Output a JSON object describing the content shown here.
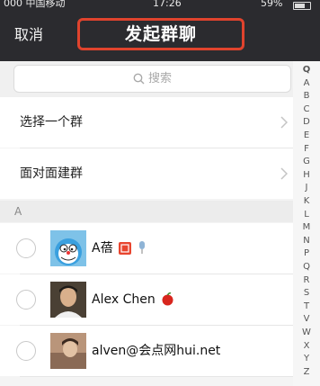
{
  "status_bar": {
    "carrier": "000 中国移动",
    "time": "17:26",
    "battery": "59%"
  },
  "nav": {
    "cancel": "取消",
    "title": "发起群聊"
  },
  "search": {
    "placeholder": "搜索"
  },
  "menu": [
    {
      "label": "选择一个群"
    },
    {
      "label": "面对面建群"
    }
  ],
  "section_header": "A",
  "contacts": [
    {
      "name": "A蓓"
    },
    {
      "name": "Alex Chen"
    },
    {
      "name": "alven@会点网hui.net"
    }
  ],
  "index_letters": [
    "Q",
    "A",
    "B",
    "C",
    "D",
    "E",
    "F",
    "G",
    "H",
    "J",
    "K",
    "L",
    "M",
    "N",
    "P",
    "Q",
    "R",
    "S",
    "T",
    "V",
    "W",
    "X",
    "Y",
    "Z"
  ],
  "colors": {
    "nav_bg": "#2b2b2f",
    "highlight_border": "#e0432d"
  },
  "icons": {
    "search": "magnifier-icon",
    "chevron": "chevron-right-icon"
  }
}
